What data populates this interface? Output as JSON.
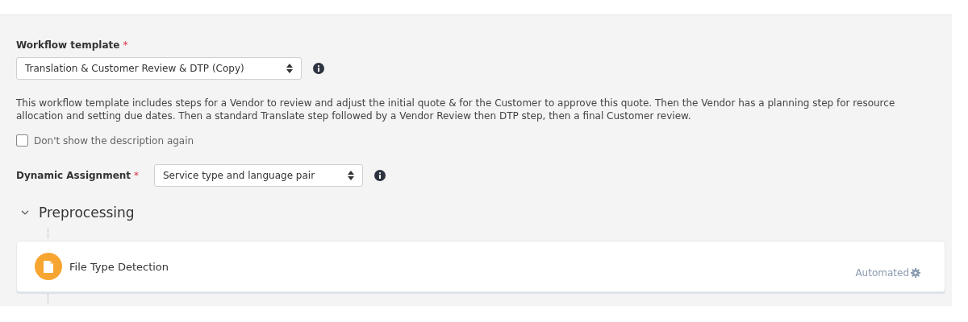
{
  "workflow_template": {
    "label": "Workflow template",
    "required_mark": "*",
    "value": "Translation & Customer Review & DTP (Copy)"
  },
  "description": "This workflow template includes steps for a Vendor to review and adjust the initial quote & for the Customer to approve this quote. Then the Vendor has a planning step for resource allocation and setting due dates. Then a standard Translate step followed by a Vendor Review then DTP step, then a final Customer review.",
  "hide_description": {
    "label": "Don't show the description again",
    "checked": false
  },
  "dynamic_assignment": {
    "label": "Dynamic Assignment",
    "required_mark": "*",
    "value": "Service type and language pair"
  },
  "section": {
    "title": "Preprocessing",
    "expanded": true,
    "steps": [
      {
        "title": "File Type Detection",
        "mode": "Automated"
      }
    ]
  }
}
